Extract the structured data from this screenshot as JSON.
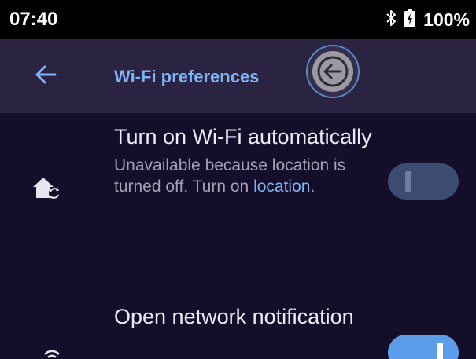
{
  "status_bar": {
    "time": "07:40",
    "battery_percent": "100%",
    "icons": [
      "bluetooth-icon",
      "battery-icon"
    ]
  },
  "app_bar": {
    "title": "Wi-Fi preferences",
    "back_icon": "arrow-left-icon",
    "floating_back_icon": "circle-arrow-left-icon"
  },
  "preferences": [
    {
      "title": "Turn on Wi-Fi automatically",
      "summary_prefix": "Unavailable because location is turned off. Turn on ",
      "summary_link": "location",
      "summary_suffix": ".",
      "icon": "home-sync-icon",
      "enabled": false
    },
    {
      "title": "Open network notification",
      "icon": "wifi-notification-icon",
      "enabled": true
    }
  ],
  "colors": {
    "background": "#150e2b",
    "app_bar": "#2a2342",
    "accent": "#7eb4f4",
    "switch_on": "#5c9de9",
    "switch_off": "#3c4b72"
  }
}
